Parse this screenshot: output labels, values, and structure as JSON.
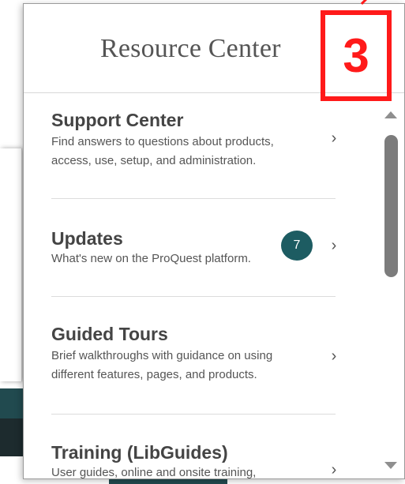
{
  "panel": {
    "title": "Resource Center"
  },
  "annotation": {
    "step_number": "3",
    "color": "#ff1a1a"
  },
  "items": [
    {
      "title": "Support Center",
      "description_line1": "Find answers to questions about products,",
      "description_line2": "access, use, setup, and administration.",
      "chevron": "›"
    },
    {
      "title": "Updates",
      "description_line1": "What's new on the ProQuest platform.",
      "badge_count": "7",
      "chevron": "›"
    },
    {
      "title": "Guided Tours",
      "description_line1": "Brief walkthroughs with guidance on using",
      "description_line2": "different features, pages, and products.",
      "chevron": "›"
    },
    {
      "title": "Training (LibGuides)",
      "description_line1": "User guides, online and onsite training,",
      "chevron": "›"
    }
  ],
  "colors": {
    "badge_bg": "#1d5c62",
    "title_text": "#444444",
    "desc_text": "#555555",
    "scroll_thumb": "#7c7c7c"
  },
  "icons": {
    "chevron": "chevron-right-icon",
    "scroll_up": "triangle-up-icon",
    "scroll_down": "triangle-down-icon"
  }
}
